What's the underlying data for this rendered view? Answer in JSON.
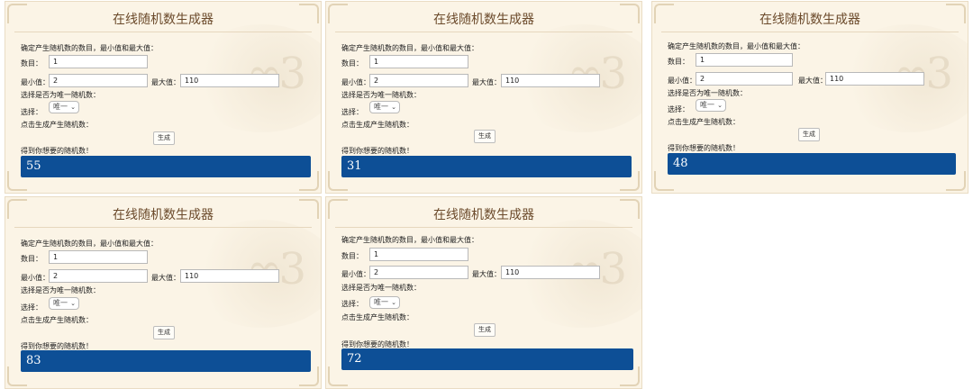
{
  "common": {
    "title": "在线随机数生成器",
    "intro": "确定产生随机数的数目，最小值和最大值：",
    "count_label": "数目：",
    "count_value": "1",
    "min_label": "最小值：",
    "min_value": "2",
    "max_label": "最大值：",
    "max_value": "110",
    "unique_prompt": "选择是否为唯一随机数：",
    "select_label": "选择：",
    "select_value": "唯一",
    "generate_prompt": "点击生成产生随机数：",
    "generate_button": "生成",
    "result_label": "得到你想要的随机数！"
  },
  "panels": [
    {
      "result": "55"
    },
    {
      "result": "31"
    },
    {
      "result": "48"
    },
    {
      "result": "83"
    },
    {
      "result": "72"
    }
  ]
}
